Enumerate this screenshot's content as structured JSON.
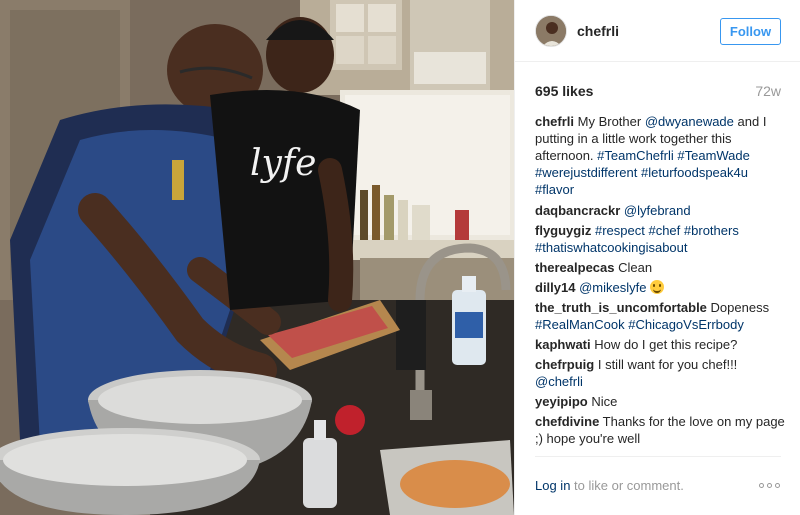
{
  "post": {
    "photo_icon": "cooking-photo"
  },
  "header": {
    "avatar_icon": "profile-avatar",
    "username": "chefrli",
    "follow_label": "Follow"
  },
  "stats": {
    "likes": "695 likes",
    "age": "72w"
  },
  "caption": {
    "author": "chefrli",
    "parts": [
      {
        "text": " My Brother ",
        "tag": false
      },
      {
        "text": "@dwyanewade",
        "tag": true
      },
      {
        "text": " and I putting in a little work together this afternoon. ",
        "tag": false
      },
      {
        "text": "#TeamChefrli",
        "tag": true
      },
      {
        "text": " ",
        "tag": false
      },
      {
        "text": "#TeamWade",
        "tag": true
      },
      {
        "text": " ",
        "tag": false
      },
      {
        "text": "#werejustdifferent",
        "tag": true
      },
      {
        "text": " ",
        "tag": false
      },
      {
        "text": "#leturfoodspeak4u",
        "tag": true
      },
      {
        "text": " ",
        "tag": false
      },
      {
        "text": "#flavor",
        "tag": true
      }
    ]
  },
  "comments": [
    {
      "author": "daqbancrackr",
      "parts": [
        {
          "text": " ",
          "tag": false
        },
        {
          "text": "@lyfebrand",
          "tag": true
        }
      ]
    },
    {
      "author": "flyguygiz",
      "parts": [
        {
          "text": " ",
          "tag": false
        },
        {
          "text": "#respect",
          "tag": true
        },
        {
          "text": " ",
          "tag": false
        },
        {
          "text": "#chef",
          "tag": true
        },
        {
          "text": " ",
          "tag": false
        },
        {
          "text": "#brothers",
          "tag": true
        },
        {
          "text": " ",
          "tag": false
        },
        {
          "text": "#thatiswhatcookingisabout",
          "tag": true
        }
      ]
    },
    {
      "author": "therealpecas",
      "parts": [
        {
          "text": " Clean",
          "tag": false
        }
      ]
    },
    {
      "author": "dilly14",
      "parts": [
        {
          "text": " ",
          "tag": false
        },
        {
          "text": "@mikeslyfe",
          "tag": true
        },
        {
          "text": " ",
          "tag": false
        }
      ],
      "emoji": "smiley-emoji"
    },
    {
      "author": "the_truth_is_uncomfortable",
      "parts": [
        {
          "text": " Dopeness ",
          "tag": false
        },
        {
          "text": "#RealManCook",
          "tag": true
        },
        {
          "text": " ",
          "tag": false
        },
        {
          "text": "#ChicagoVsErrbody",
          "tag": true
        }
      ]
    },
    {
      "author": "kaphwati",
      "parts": [
        {
          "text": " How do I get this recipe?",
          "tag": false
        }
      ]
    },
    {
      "author": "chefrpuig",
      "parts": [
        {
          "text": " I still want for you chef!!! ",
          "tag": false
        },
        {
          "text": "@chefrli",
          "tag": true
        }
      ]
    },
    {
      "author": "yeyipipo",
      "parts": [
        {
          "text": " Nice",
          "tag": false
        }
      ]
    },
    {
      "author": "chefdivine",
      "parts": [
        {
          "text": " Thanks for the love on my page ;) hope you're well",
          "tag": false
        }
      ]
    }
  ],
  "footer": {
    "login_link": "Log in",
    "login_text": " to like or comment.",
    "more_icon": "more-options-icon"
  },
  "colors": {
    "accent": "#3897f0",
    "link": "#003569",
    "muted": "#999999",
    "text": "#262626"
  }
}
